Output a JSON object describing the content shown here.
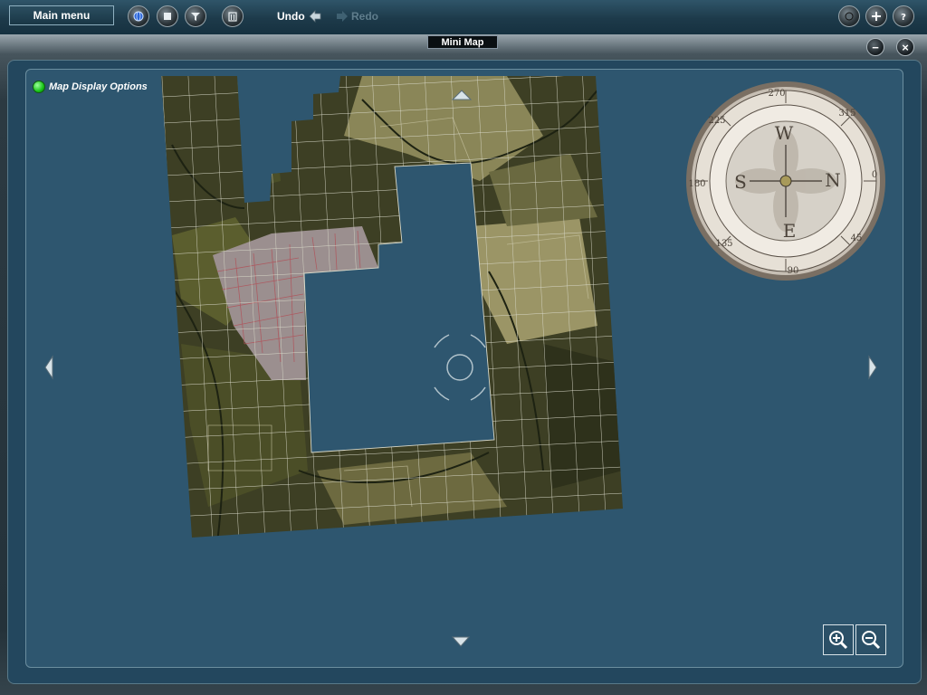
{
  "toolbar": {
    "main_menu_label": "Main menu",
    "undo_label": "Undo",
    "redo_label": "Redo",
    "left_buttons": [
      "globe-icon",
      "stop-icon",
      "filter-icon",
      "trash-icon"
    ],
    "right_buttons": [
      "camera-icon",
      "add-icon",
      "help-icon"
    ]
  },
  "window": {
    "title": "Mini Map",
    "minimize_label": "−",
    "close_label": "×"
  },
  "map": {
    "display_options_label": "Map Display Options",
    "compass_labels": [
      "N",
      "E",
      "S",
      "W"
    ],
    "compass_degrees": [
      "270",
      "315",
      "0",
      "45",
      "90",
      "135",
      "180",
      "225"
    ]
  },
  "colors": {
    "panel_bg": "#2e566f",
    "accent_green": "#18c418",
    "map_dark": "#3d3f24",
    "map_light": "#9b9566",
    "urban": "#9b8f8f"
  }
}
